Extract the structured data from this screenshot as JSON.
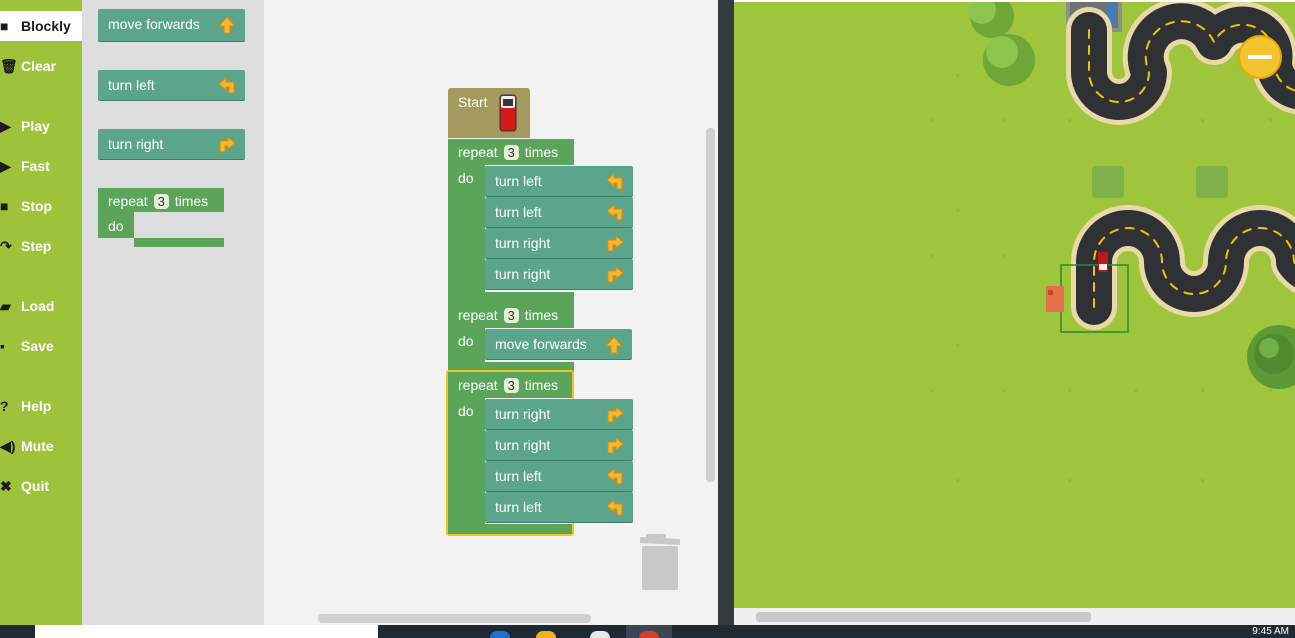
{
  "menu": {
    "items": [
      {
        "label": "Blockly",
        "icon": "blockly-icon",
        "glyph": "■"
      },
      {
        "label": "Clear",
        "icon": "trash-icon",
        "glyph": "🗑"
      },
      {
        "label": "Play",
        "icon": "play-icon",
        "glyph": "▶"
      },
      {
        "label": "Fast",
        "icon": "fast-icon",
        "glyph": "▶"
      },
      {
        "label": "Stop",
        "icon": "stop-icon",
        "glyph": "■"
      },
      {
        "label": "Step",
        "icon": "step-icon",
        "glyph": "↷"
      },
      {
        "label": "Load",
        "icon": "folder-icon",
        "glyph": "▰"
      },
      {
        "label": "Save",
        "icon": "save-icon",
        "glyph": "▪"
      },
      {
        "label": "Help",
        "icon": "help-icon",
        "glyph": "?"
      },
      {
        "label": "Mute",
        "icon": "speaker-icon",
        "glyph": "◀)"
      },
      {
        "label": "Quit",
        "icon": "quit-icon",
        "glyph": "✖"
      }
    ]
  },
  "toolbox": {
    "move_forwards": "move forwards",
    "turn_left": "turn left",
    "turn_right": "turn right",
    "repeat": "repeat",
    "repeat_count": "3",
    "times": "times",
    "do": "do"
  },
  "program": {
    "start": "Start",
    "repeat_label": "repeat",
    "times_label": "times",
    "do_label": "do",
    "loops": [
      {
        "count": "3",
        "steps": [
          "turn left",
          "turn left",
          "turn right",
          "turn right"
        ]
      },
      {
        "count": "3",
        "steps": [
          "move forwards"
        ]
      },
      {
        "count": "3",
        "steps": [
          "turn right",
          "turn right",
          "turn left",
          "turn left"
        ]
      }
    ]
  },
  "taskbar": {
    "time": "9:45 AM"
  },
  "colors": {
    "menu_green": "#9ec33b",
    "action_block": "#5ba58c",
    "loop_block": "#5ba55b",
    "start_block": "#a49a5d",
    "selected_outline": "#f0c419",
    "grass": "#9fc53c"
  }
}
